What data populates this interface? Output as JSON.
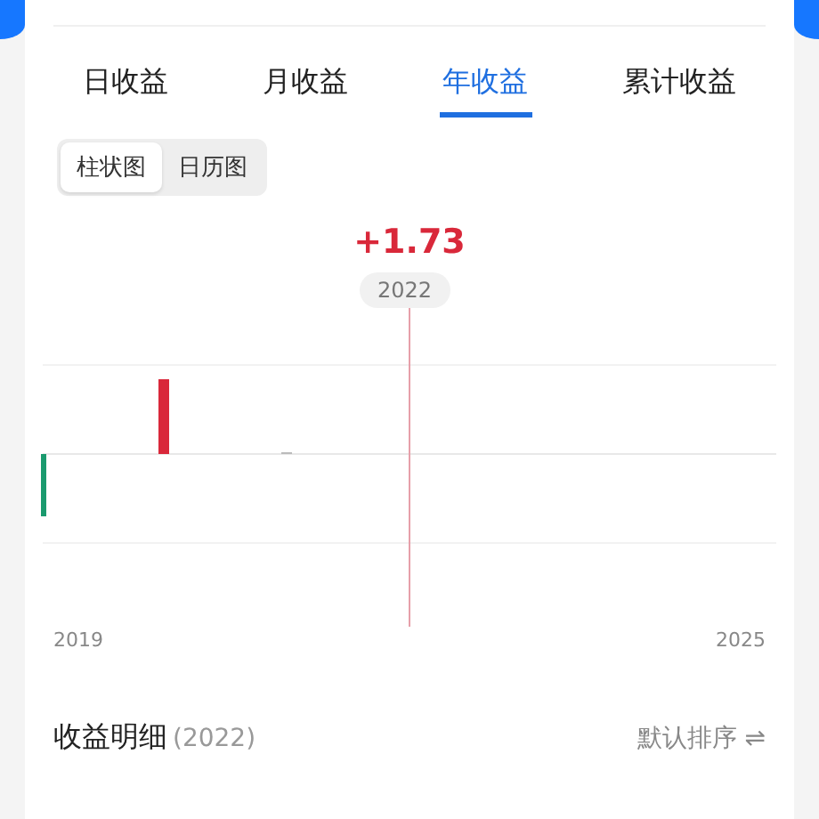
{
  "tabs": [
    {
      "label": "日收益",
      "selected": false
    },
    {
      "label": "月收益",
      "selected": false
    },
    {
      "label": "年收益",
      "selected": true
    },
    {
      "label": "累计收益",
      "selected": false
    }
  ],
  "view_toggle": [
    {
      "label": "柱状图",
      "selected": true
    },
    {
      "label": "日历图",
      "selected": false
    }
  ],
  "chart": {
    "value": "+1.73",
    "selected_year": "2022",
    "x_start": "2019",
    "x_end": "2025"
  },
  "detail": {
    "title": "收益明细",
    "year": "(2022)",
    "sort": "默认排序",
    "sort_icon": "⇌"
  }
}
